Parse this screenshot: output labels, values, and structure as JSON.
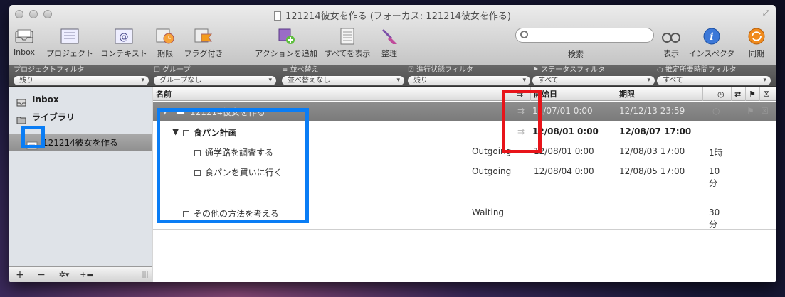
{
  "window": {
    "title": "121214彼女を作る (フォーカス: 121214彼女を作る)"
  },
  "toolbar": {
    "inbox": "Inbox",
    "projects": "プロジェクト",
    "contexts": "コンテキスト",
    "due": "期限",
    "flagged": "フラグ付き",
    "add_action": "アクションを追加",
    "show_all": "すべてを表示",
    "clean_up": "整理",
    "search_label": "検索",
    "view": "表示",
    "inspector": "インスペクタ",
    "sync": "同期"
  },
  "filters": [
    {
      "label": "プロジェクトフィルタ",
      "value": "残り"
    },
    {
      "label": "グループ",
      "value": "グループなし"
    },
    {
      "label": "並べ替え",
      "value": "並べ替えなし"
    },
    {
      "label": "進行状態フィルタ",
      "value": "残り"
    },
    {
      "label": "ステータスフィルタ",
      "value": "すべて"
    },
    {
      "label": "推定所要時間フィルタ",
      "value": "すべて"
    }
  ],
  "sidebar": {
    "items": [
      {
        "label": "Inbox"
      },
      {
        "label": "ライブラリ"
      },
      {
        "label": "121214彼女を作る"
      }
    ]
  },
  "columns": {
    "name": "名前",
    "start": "開始日",
    "due": "期限"
  },
  "rows": [
    {
      "name": "121214彼女を作る",
      "context": "",
      "start": "12/07/01 0:00",
      "due": "12/12/13 23:59",
      "duration": ""
    },
    {
      "name": "食パン計画",
      "context": "",
      "start": "12/08/01 0:00",
      "due": "12/08/07 17:00",
      "duration": ""
    },
    {
      "name": "通学路を調査する",
      "context": "Outgoing",
      "start": "12/08/01 0:00",
      "due": "12/08/03 17:00",
      "duration": "1時"
    },
    {
      "name": "食パンを買いに行く",
      "context": "Outgoing",
      "start": "12/08/04 0:00",
      "due": "12/08/05 17:00",
      "duration_l1": "10",
      "duration_l2": "分"
    },
    {
      "name": "その他の方法を考える",
      "context": "Waiting",
      "start": "",
      "due": "",
      "duration_l1": "30",
      "duration_l2": "分"
    }
  ],
  "colors": {
    "highlight_blue": "#0a7df5",
    "highlight_red": "#e8141a"
  }
}
